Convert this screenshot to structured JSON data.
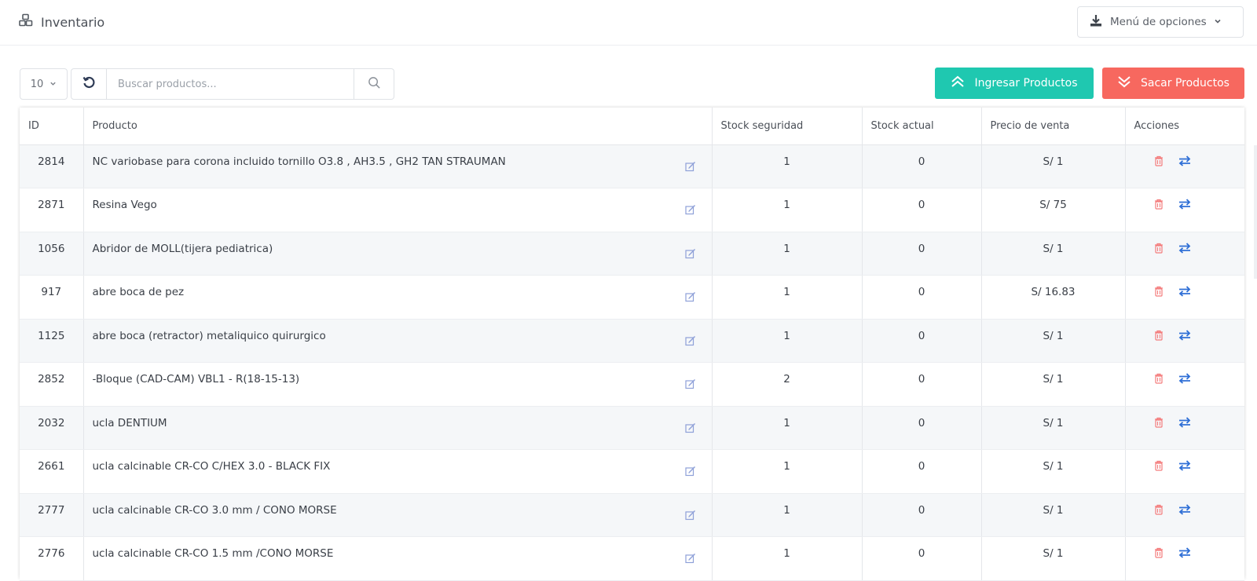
{
  "header": {
    "title": "Inventario",
    "menu_label": "Menú de opciones"
  },
  "toolbar": {
    "page_size": "10",
    "search_placeholder": "Buscar productos...",
    "search_value": "",
    "btn_ingresar": "Ingresar Productos",
    "btn_sacar": "Sacar Productos"
  },
  "table": {
    "columns": [
      "ID",
      "Producto",
      "Stock seguridad",
      "Stock actual",
      "Precio de venta",
      "Acciones"
    ],
    "rows": [
      {
        "id": "2814",
        "producto": "NC variobase para corona incluido tornillo O3.8 , AH3.5 , GH2 TAN STRAUMAN",
        "stock_seguridad": "1",
        "stock_actual": "0",
        "precio": "S/ 1"
      },
      {
        "id": "2871",
        "producto": "Resina Vego",
        "stock_seguridad": "1",
        "stock_actual": "0",
        "precio": "S/ 75"
      },
      {
        "id": "1056",
        "producto": "Abridor de MOLL(tijera pediatrica)",
        "stock_seguridad": "1",
        "stock_actual": "0",
        "precio": "S/ 1"
      },
      {
        "id": "917",
        "producto": "abre boca de pez",
        "stock_seguridad": "1",
        "stock_actual": "0",
        "precio": "S/ 16.83"
      },
      {
        "id": "1125",
        "producto": "abre boca (retractor) metaliquico quirurgico",
        "stock_seguridad": "1",
        "stock_actual": "0",
        "precio": "S/ 1"
      },
      {
        "id": "2852",
        "producto": "-Bloque (CAD-CAM) VBL1 - R(18-15-13)",
        "stock_seguridad": "2",
        "stock_actual": "0",
        "precio": "S/ 1"
      },
      {
        "id": "2032",
        "producto": "ucla DENTIUM",
        "stock_seguridad": "1",
        "stock_actual": "0",
        "precio": "S/ 1"
      },
      {
        "id": "2661",
        "producto": "ucla calcinable CR-CO C/HEX 3.0 - BLACK FIX",
        "stock_seguridad": "1",
        "stock_actual": "0",
        "precio": "S/ 1"
      },
      {
        "id": "2777",
        "producto": "ucla calcinable CR-CO 3.0 mm / CONO MORSE",
        "stock_seguridad": "1",
        "stock_actual": "0",
        "precio": "S/ 1"
      },
      {
        "id": "2776",
        "producto": "ucla calcinable CR-CO 1.5 mm /CONO MORSE",
        "stock_seguridad": "1",
        "stock_actual": "0",
        "precio": "S/ 1"
      }
    ]
  },
  "colors": {
    "accent_teal": "#1fc8b0",
    "accent_red": "#f7685f",
    "edit_icon": "#8ea0d8",
    "delete_icon": "#f47c7c",
    "transfer_icon": "#2f6fd6"
  },
  "icons": {
    "title": "cubes-icon",
    "menu": "download-icon",
    "edit": "edit-icon",
    "delete": "trash-icon",
    "transfer": "exchange-icon"
  }
}
